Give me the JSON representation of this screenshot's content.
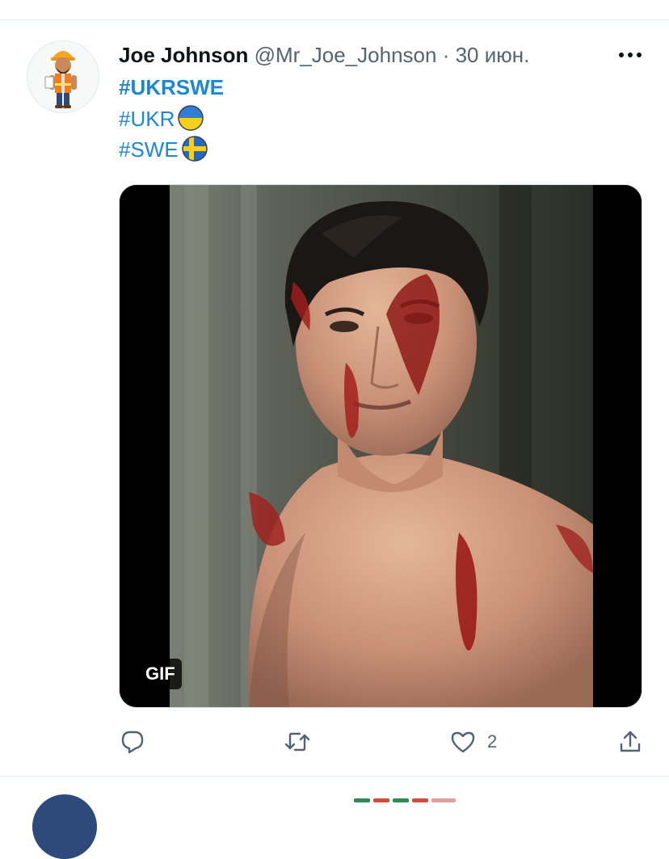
{
  "tweet": {
    "author_name": "Joe Johnson",
    "handle": "@Mr_Joe_Johnson",
    "separator": "·",
    "time": "30 июн.",
    "more_icon": "more-horizontal-icon",
    "lines": [
      {
        "text": "#UKRSWE",
        "flag": null
      },
      {
        "text": "#UKR",
        "flag": "ukraine-flag"
      },
      {
        "text": "#SWE",
        "flag": "sweden-flag"
      }
    ],
    "media": {
      "badge": "GIF",
      "description_icon": "gif-video-thumbnail"
    },
    "actions": {
      "reply_icon": "reply-icon",
      "retweet_icon": "retweet-icon",
      "like_icon": "heart-icon",
      "like_count": "2",
      "share_icon": "share-icon"
    }
  },
  "colors": {
    "link": "#1b87d6",
    "secondary_text": "#536471",
    "divider": "#e6ecf0"
  }
}
